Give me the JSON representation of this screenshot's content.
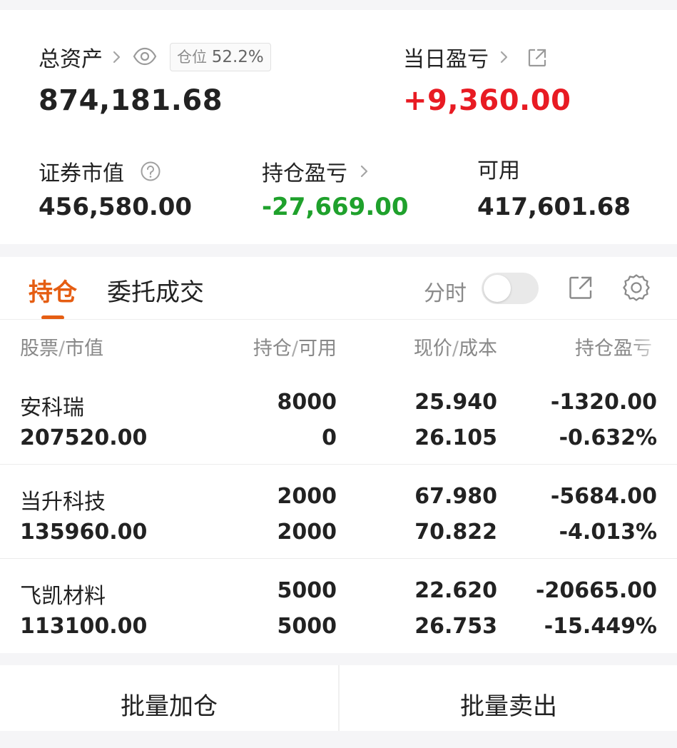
{
  "summary": {
    "total_assets_label": "总资产",
    "total_assets_value": "874,181.68",
    "position_ratio_label": "仓位",
    "position_ratio_value": "52.2%",
    "daily_pnl_label": "当日盈亏",
    "daily_pnl_value": "+9,360.00",
    "market_value_label": "证券市值",
    "market_value_value": "456,580.00",
    "holding_pnl_label": "持仓盈亏",
    "holding_pnl_value": "-27,669.00",
    "available_label": "可用",
    "available_value": "417,601.68"
  },
  "tabs": [
    {
      "label": "持仓",
      "active": true
    },
    {
      "label": "委托成交",
      "active": false
    }
  ],
  "toolbar": {
    "timeshare_label": "分时",
    "timeshare_on": false
  },
  "columns": {
    "stock": "股票",
    "market_value": "市值",
    "holding": "持仓",
    "available": "可用",
    "price": "现价",
    "cost": "成本",
    "pnl": "持仓盈亏"
  },
  "holdings": [
    {
      "name": "安科瑞",
      "market_value": "207520.00",
      "holding": "8000",
      "available": "0",
      "price": "25.940",
      "cost": "26.105",
      "pnl": "-1320.00",
      "pnl_pct": "-0.632%"
    },
    {
      "name": "当升科技",
      "market_value": "135960.00",
      "holding": "2000",
      "available": "2000",
      "price": "67.980",
      "cost": "70.822",
      "pnl": "-5684.00",
      "pnl_pct": "-4.013%"
    },
    {
      "name": "飞凯材料",
      "market_value": "113100.00",
      "holding": "5000",
      "available": "5000",
      "price": "22.620",
      "cost": "26.753",
      "pnl": "-20665.00",
      "pnl_pct": "-15.449%"
    }
  ],
  "actions": {
    "batch_add": "批量加仓",
    "batch_sell": "批量卖出"
  },
  "colors": {
    "accent": "#e55d12",
    "gain": "#e81b23",
    "loss": "#1fa12c"
  },
  "icons": [
    "chevron-right-icon",
    "eye-icon",
    "external-link-icon",
    "help-circle-icon",
    "share-icon",
    "gear-icon"
  ]
}
